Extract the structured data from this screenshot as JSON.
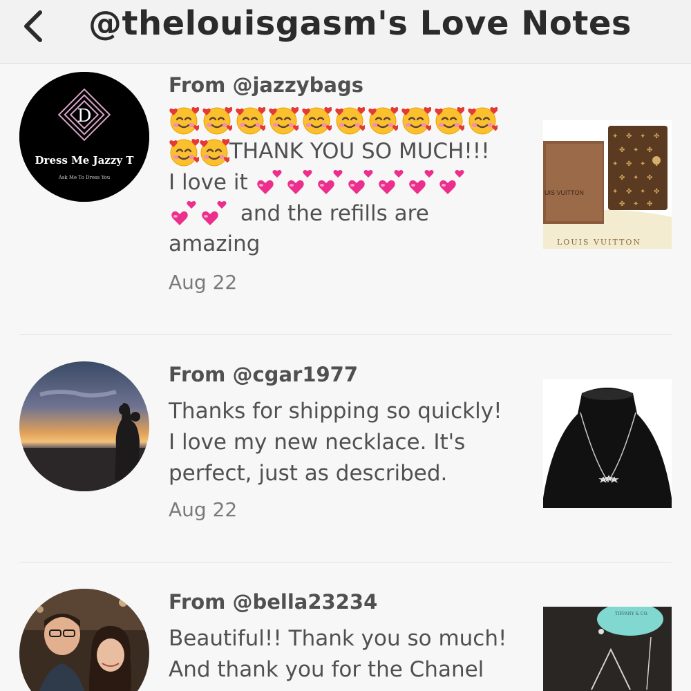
{
  "header": {
    "title": "@thelouisgasm's Love Notes"
  },
  "notes": [
    {
      "from": "From @jazzybags",
      "avatar_text": "Dress Me Jazzy T",
      "avatar_subtext": "Ask Me To Dress You",
      "avatar_letter": "D",
      "message_line2": "THANK YOU SO MUCH!!!",
      "message_line3": "I love it",
      "message_line4": "and the refills are",
      "message_line5": "amazing",
      "date": "Aug 22",
      "thumb_brand": "UIS VUITTON",
      "thumb_brand2": "LOUIS VUITTON"
    },
    {
      "from": "From @cgar1977",
      "message": "Thanks for shipping so quickly! I love my new necklace. It's perfect, just as described.",
      "date": "Aug 22"
    },
    {
      "from": "From @bella23234",
      "message": "Beautiful!! Thank you so much! And thank you for the Chanel",
      "thumb_brand": "TIFFANY & CO."
    }
  ],
  "icons": [
    "back-arrow-icon",
    "smiling-face-with-hearts-emoji",
    "two-hearts-emoji"
  ],
  "colors": {
    "header_bg": "#f2f2f2",
    "page_bg": "#f7f7f7",
    "text": "#505050",
    "date": "#7a7a7a"
  }
}
